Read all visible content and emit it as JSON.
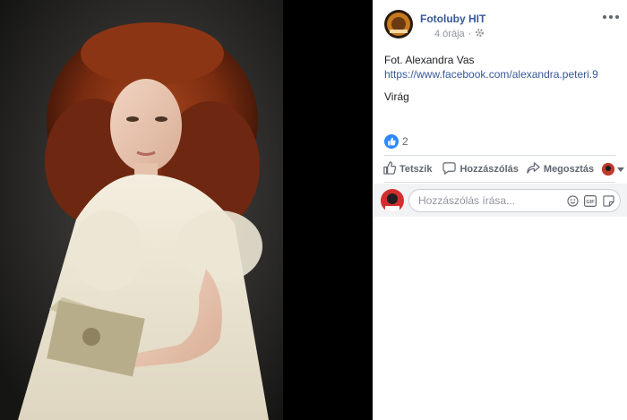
{
  "post": {
    "page_name": "Fotoluby HIT",
    "time_ago": "4 órája",
    "visibility_icon": "gear-icon",
    "caption_prefix": "Fot. Alexandra Vas ",
    "caption_link": "https://www.facebook.com/alexandra.peteri.9",
    "caption_line2": "Virág",
    "reaction_count": "2"
  },
  "actions": {
    "like_label": "Tetszik",
    "comment_label": "Hozzászólás",
    "share_label": "Megosztás"
  },
  "comment_box": {
    "placeholder": "Hozzászólás írása..."
  },
  "colors": {
    "accent": "#385898",
    "like_blue": "#2d88ff",
    "muted": "#606770"
  }
}
